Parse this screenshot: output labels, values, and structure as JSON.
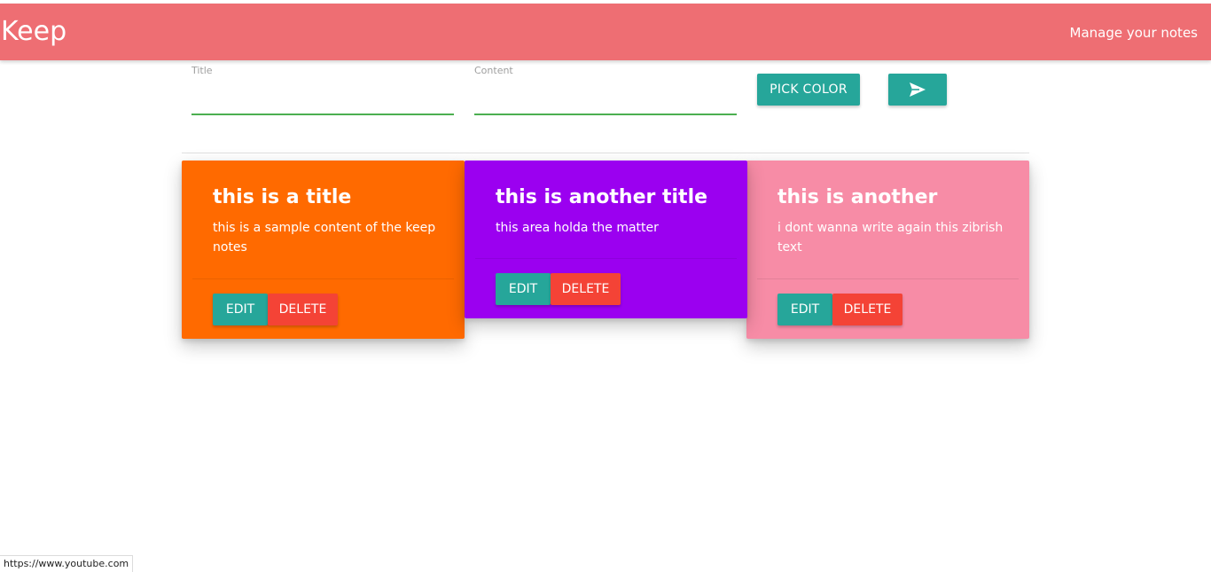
{
  "navbar": {
    "brand": "Keep",
    "link": "Manage your notes",
    "color": "#ee6e73"
  },
  "form": {
    "title_label": "Title",
    "title_value": "",
    "content_label": "Content",
    "content_value": "",
    "pick_color_label": "PICK COLOR",
    "send_icon": "send-icon",
    "accent_color": "#26a69a"
  },
  "notes": [
    {
      "title": "this is a title",
      "content": "this is a sample content of the keep notes",
      "color": "#ff6a00",
      "edit_label": "EDIT",
      "delete_label": "DELETE"
    },
    {
      "title": "this is another title",
      "content": "this area holda the matter",
      "color": "#9b00f0",
      "edit_label": "EDIT",
      "delete_label": "DELETE"
    },
    {
      "title": "this is another",
      "content": "i dont wanna write again this zibrish text",
      "color": "#f78ca6",
      "edit_label": "EDIT",
      "delete_label": "DELETE"
    }
  ],
  "status_bar": {
    "url": "https://www.youtube.com"
  }
}
